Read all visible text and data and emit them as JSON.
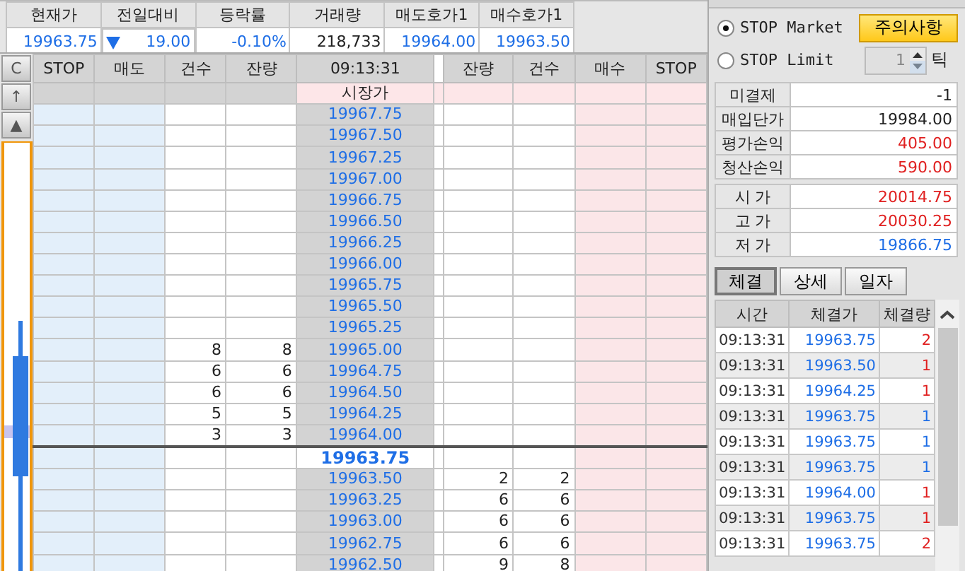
{
  "summary": {
    "columns": [
      "현재가",
      "전일대비",
      "등락률",
      "거래량",
      "매도호가1",
      "매수호가1"
    ],
    "values": [
      {
        "text": "19963.75",
        "color": "#1e6ee6"
      },
      {
        "text": "19.00",
        "color": "#1e6ee6",
        "falling": true
      },
      {
        "text": "-0.10%",
        "color": "#1e6ee6"
      },
      {
        "text": "218,733",
        "color": "#222222"
      },
      {
        "text": "19964.00",
        "color": "#1e6ee6"
      },
      {
        "text": "19963.50",
        "color": "#1e6ee6"
      }
    ]
  },
  "order_book": {
    "side_buttons": [
      "C",
      "↑",
      "▲"
    ],
    "columns": [
      "STOP",
      "매도",
      "건수",
      "잔량",
      "09:13:31",
      "잔량",
      "건수",
      "매수",
      "STOP"
    ],
    "market_label": "시장가",
    "rows": [
      {
        "price": "19967.75",
        "current": false
      },
      {
        "price": "19967.50",
        "current": false
      },
      {
        "price": "19967.25",
        "current": false
      },
      {
        "price": "19967.00",
        "current": false
      },
      {
        "price": "19966.75",
        "current": false
      },
      {
        "price": "19966.50",
        "current": false
      },
      {
        "price": "19966.25",
        "current": false
      },
      {
        "price": "19966.00",
        "current": false
      },
      {
        "price": "19965.75",
        "current": false
      },
      {
        "price": "19965.50",
        "current": false
      },
      {
        "price": "19965.25",
        "current": false
      },
      {
        "price": "19965.00",
        "sell_count": "8",
        "sell_qty": "8",
        "current": false
      },
      {
        "price": "19964.75",
        "sell_count": "6",
        "sell_qty": "6",
        "current": false
      },
      {
        "price": "19964.50",
        "sell_count": "6",
        "sell_qty": "6",
        "current": false
      },
      {
        "price": "19964.25",
        "sell_count": "5",
        "sell_qty": "5",
        "current": false
      },
      {
        "price": "19964.00",
        "sell_count": "3",
        "sell_qty": "3",
        "current": false
      },
      {
        "price": "19963.75",
        "current": true
      },
      {
        "price": "19963.50",
        "buy_qty": "2",
        "buy_count": "2",
        "current": false
      },
      {
        "price": "19963.25",
        "buy_qty": "6",
        "buy_count": "6",
        "current": false
      },
      {
        "price": "19963.00",
        "buy_qty": "6",
        "buy_count": "6",
        "current": false
      },
      {
        "price": "19962.75",
        "buy_qty": "6",
        "buy_count": "6",
        "current": false
      },
      {
        "price": "19962.50",
        "buy_qty": "9",
        "buy_count": "8",
        "current": false
      }
    ]
  },
  "stop_types": [
    {
      "label": "STOP Market",
      "selected": true
    },
    {
      "label": "STOP Limit",
      "selected": false
    }
  ],
  "caution_button": "주의사항",
  "tick_field": {
    "value": "1",
    "unit": "틱"
  },
  "position": [
    {
      "label": "미결제",
      "value": "-1",
      "color": "#222222"
    },
    {
      "label": "매입단가",
      "value": "19984.00",
      "color": "#222222"
    },
    {
      "label": "평가손익",
      "value": "405.00",
      "color": "#e02020"
    },
    {
      "label": "청산손익",
      "value": "590.00",
      "color": "#e02020"
    }
  ],
  "prices": [
    {
      "label": "시 가",
      "value": "20014.75",
      "color": "#e02020"
    },
    {
      "label": "고 가",
      "value": "20030.25",
      "color": "#e02020"
    },
    {
      "label": "저 가",
      "value": "19866.75",
      "color": "#1e6ee6"
    }
  ],
  "tabs": [
    {
      "label": "체결",
      "selected": true
    },
    {
      "label": "상세",
      "selected": false
    },
    {
      "label": "일자",
      "selected": false
    }
  ],
  "trades": {
    "columns": [
      "시간",
      "체결가",
      "체결량"
    ],
    "rows": [
      {
        "time": "09:13:31",
        "price": "19963.75",
        "qty": "2",
        "color": "#e02020"
      },
      {
        "time": "09:13:31",
        "price": "19963.50",
        "qty": "1",
        "color": "#e02020"
      },
      {
        "time": "09:13:31",
        "price": "19964.25",
        "qty": "1",
        "color": "#e02020"
      },
      {
        "time": "09:13:31",
        "price": "19963.75",
        "qty": "1",
        "color": "#1e6ee6"
      },
      {
        "time": "09:13:31",
        "price": "19963.75",
        "qty": "1",
        "color": "#1e6ee6"
      },
      {
        "time": "09:13:31",
        "price": "19963.75",
        "qty": "1",
        "color": "#1e6ee6"
      },
      {
        "time": "09:13:31",
        "price": "19964.00",
        "qty": "1",
        "color": "#e02020"
      },
      {
        "time": "09:13:31",
        "price": "19963.75",
        "qty": "1",
        "color": "#e02020"
      },
      {
        "time": "09:13:31",
        "price": "19963.75",
        "qty": "2",
        "color": "#e02020"
      }
    ]
  }
}
